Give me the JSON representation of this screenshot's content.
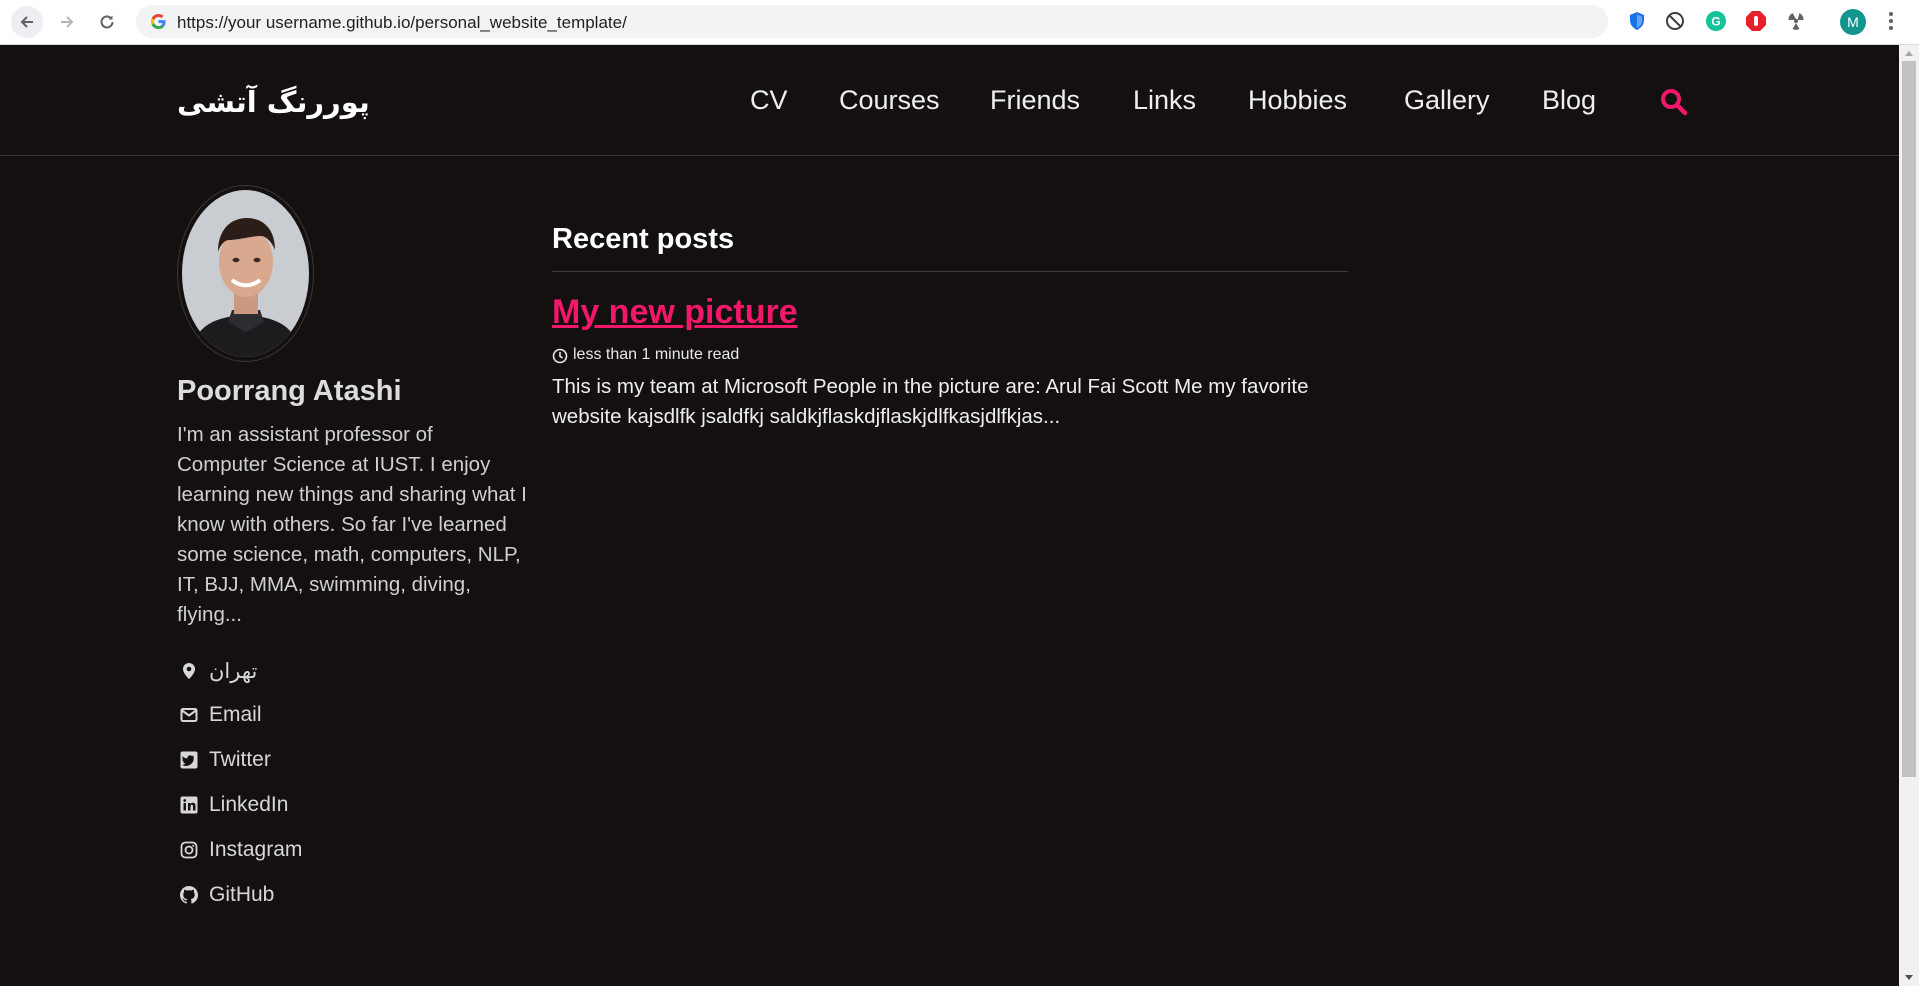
{
  "browser": {
    "url": "https://your username.github.io/personal_website_template/",
    "profile_initial": "M",
    "extensions": [
      "shield-extension-icon",
      "block-extension-icon",
      "grammarly-extension-icon",
      "adblock-extension-icon",
      "radiation-extension-icon"
    ]
  },
  "site": {
    "title": "پوررنگ آتشی",
    "accent": "#f2176a",
    "nav": [
      "CV",
      "Courses",
      "Friends",
      "Links",
      "Hobbies",
      "Gallery",
      "Blog"
    ]
  },
  "author": {
    "name": "Poorrang Atashi",
    "bio": "I'm an assistant professor of Computer Science at IUST. I enjoy learning new things and sharing what I know with others. So far I've learned some science, math, computers, NLP, IT, BJJ, MMA, swimming, diving, flying...",
    "location": "تهران",
    "links": [
      {
        "icon": "envelope-icon",
        "label": "Email"
      },
      {
        "icon": "twitter-icon",
        "label": "Twitter"
      },
      {
        "icon": "linkedin-icon",
        "label": "LinkedIn"
      },
      {
        "icon": "instagram-icon",
        "label": "Instagram"
      },
      {
        "icon": "github-icon",
        "label": "GitHub"
      }
    ]
  },
  "main": {
    "heading": "Recent posts",
    "posts": [
      {
        "title": "My new picture",
        "read_time": "less than 1 minute read",
        "excerpt": "This is my team at Microsoft People in the picture are: Arul Fai Scott Me my favorite website kajsdlfk jsaldfkj saldkjflaskdjflaskjdlfkasjdlfkjas..."
      }
    ]
  }
}
